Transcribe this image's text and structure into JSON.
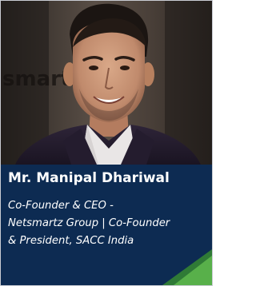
{
  "profile": {
    "name": "Mr. Manipal Dhariwal",
    "role_lines": [
      "Co-Founder & CEO -",
      "Netsmartz Group | Co-Founder",
      "& President, SACC India"
    ],
    "background_sign_text": "smartz"
  },
  "colors": {
    "panel": "#0d2b52",
    "accent_light": "#58b04a",
    "accent_dark": "#2f7a36"
  }
}
